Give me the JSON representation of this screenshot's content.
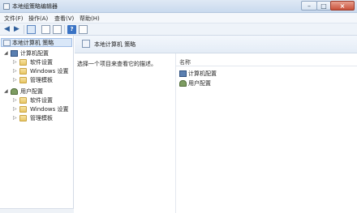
{
  "window": {
    "title": "本地组策略编辑器",
    "controls": {
      "minimize": "–",
      "maximize": "□",
      "close": "×"
    }
  },
  "menu": {
    "items": [
      "文件(F)",
      "操作(A)",
      "查看(V)",
      "帮助(H)"
    ]
  },
  "toolbar": {
    "back_icon": "arrow-left-icon",
    "forward_icon": "arrow-right-icon",
    "help_label": "?"
  },
  "tree": {
    "root": "本地计算机 策略",
    "computer_config": "计算机配置",
    "computer_children": [
      "软件设置",
      "Windows 设置",
      "管理模板"
    ],
    "user_config": "用户配置",
    "user_children": [
      "软件设置",
      "Windows 设置",
      "管理模板"
    ]
  },
  "content": {
    "header_title": "本地计算机 策略",
    "description": "选择一个项目来查看它的描述。",
    "column_name": "名称",
    "items": [
      "计算机配置",
      "用户配置"
    ]
  }
}
